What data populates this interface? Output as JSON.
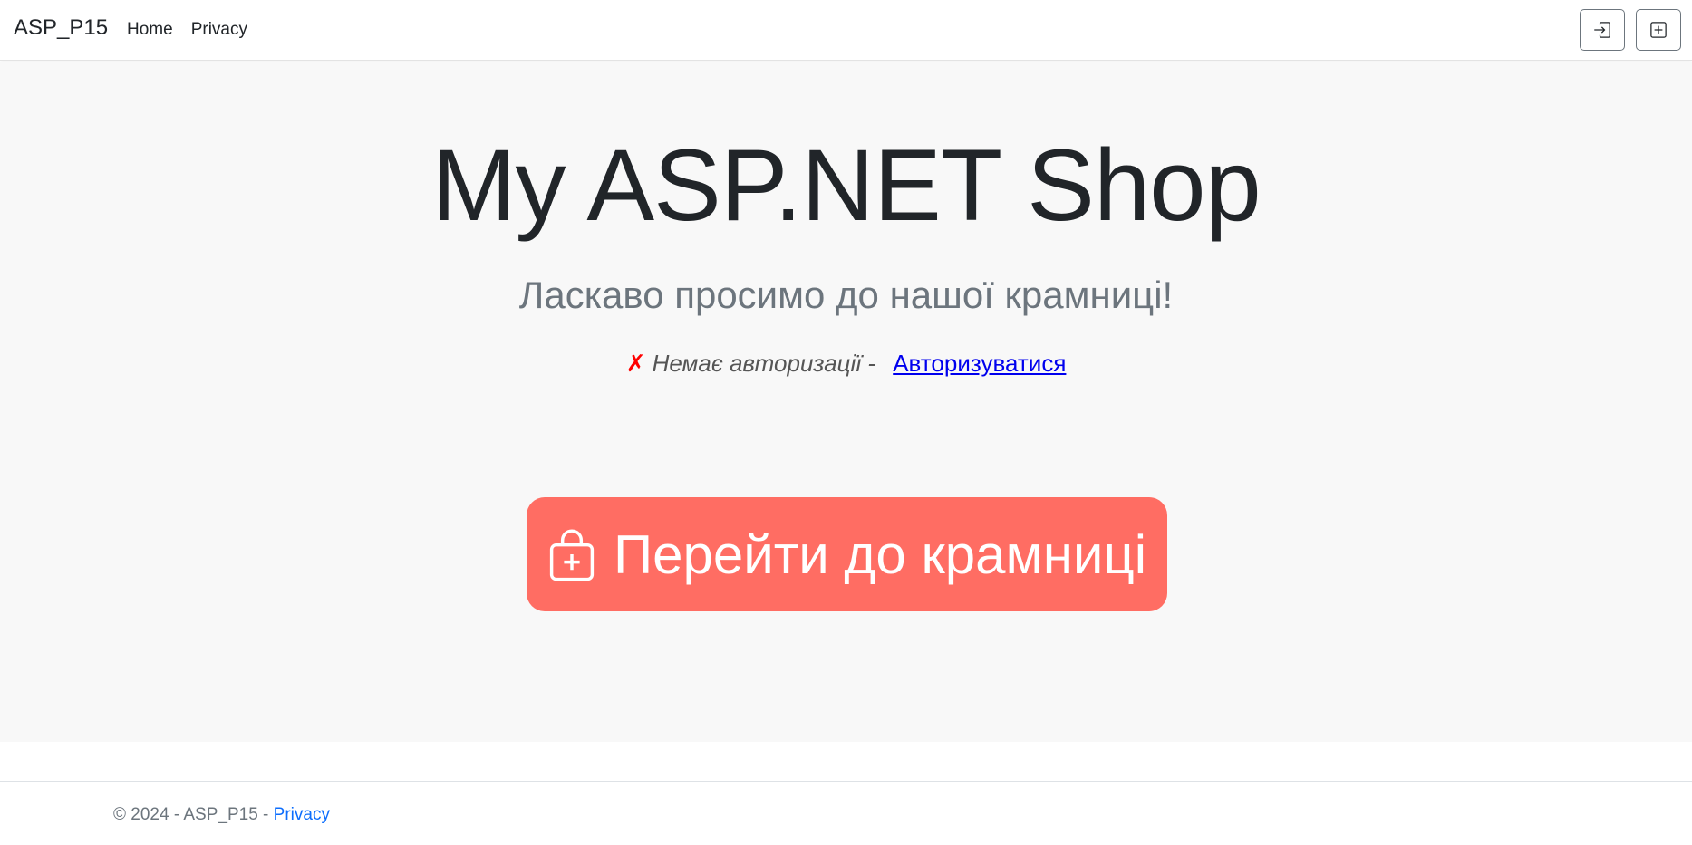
{
  "navbar": {
    "brand": "ASP_P15",
    "links": [
      "Home",
      "Privacy"
    ],
    "actions": [
      {
        "icon": "box-arrow-in-right-icon"
      },
      {
        "icon": "plus-square-icon"
      }
    ]
  },
  "hero": {
    "title": "My ASP.NET Shop",
    "lead": "Ласкаво просимо до нашої крамниці!",
    "auth": {
      "mark": "✗",
      "status": "Немає авторизації - ",
      "link": "Авторизуватися"
    },
    "shop_button": {
      "icon": "bag-plus-icon",
      "label": "Перейти до крамниці"
    }
  },
  "footer": {
    "text": "© 2024 - ASP_P15 - ",
    "link": "Privacy"
  },
  "colors": {
    "shop_button": "#ff6d63",
    "hero_bg": "#f8f8f8",
    "auth_mark": "#ff0000",
    "footer_link": "#0d6efd"
  }
}
